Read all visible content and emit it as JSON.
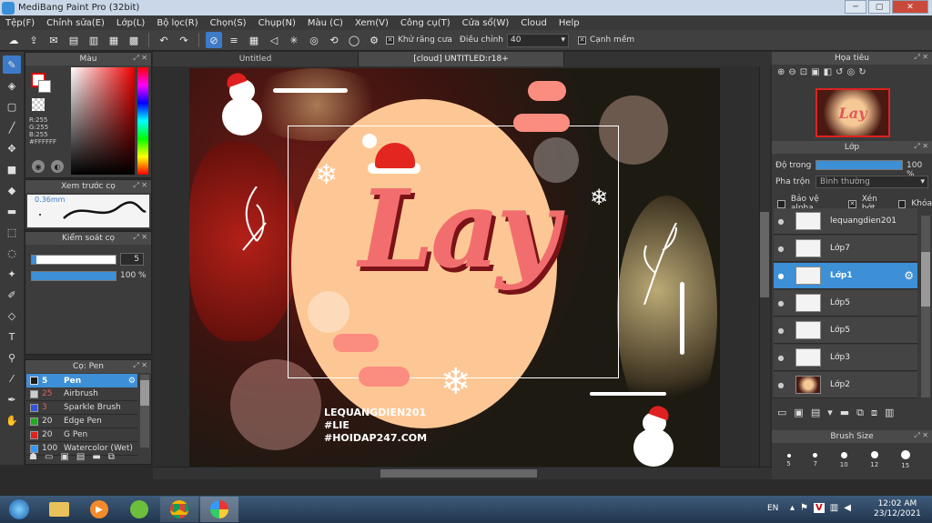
{
  "window": {
    "title": "MediBang Paint Pro (32bit)",
    "controls": [
      "─",
      "▢",
      "✕"
    ]
  },
  "menu": [
    "Tệp(F)",
    "Chỉnh sửa(E)",
    "Lớp(L)",
    "Bộ lọc(R)",
    "Chọn(S)",
    "Chụp(N)",
    "Màu (C)",
    "Xem(V)",
    "Công cụ(T)",
    "Cửa sổ(W)",
    "Cloud",
    "Help"
  ],
  "toolbar": {
    "antialias_label": "Khử răng cưa",
    "adjust_label": "Điều chỉnh",
    "adjust_value": "40",
    "sharp_label": "Cạnh mềm"
  },
  "color_panel": {
    "title": "Màu",
    "r": "R:255",
    "g": "G:255",
    "b": "B:255",
    "hex": "#FFFFFF"
  },
  "preview_panel": {
    "title": "Xem trước cọ",
    "size": "0.36mm"
  },
  "brush_control": {
    "title": "Kiểm soát cọ",
    "size_value": "5",
    "opacity_value": "100 %"
  },
  "brush_list": {
    "title": "Cọ: Pen",
    "items": [
      {
        "size": "5",
        "name": "Pen",
        "color": "#1a1a1a"
      },
      {
        "size": "25",
        "name": "Airbrush",
        "color": "#cccccc"
      },
      {
        "size": "3",
        "name": "Sparkle Brush",
        "color": "#3355dd"
      },
      {
        "size": "20",
        "name": "Edge Pen",
        "color": "#22aa22"
      },
      {
        "size": "20",
        "name": "G Pen",
        "color": "#dd2222"
      },
      {
        "size": "100",
        "name": "Watercolor (Wet)",
        "color": "#3399ff"
      }
    ]
  },
  "tabs": {
    "tab1": "Untitled",
    "tab2": "[cloud] UNTITLED:r18+"
  },
  "canvas": {
    "main_text": "Lay",
    "credit1": "LEQUANGDIEN201",
    "credit2": "#LIE",
    "credit3": "#HOIDAP247.COM"
  },
  "navigator": {
    "title": "Họa tiêu",
    "thumb_text": "Lay"
  },
  "layer_panel": {
    "title": "Lớp",
    "opacity_label": "Độ trong",
    "opacity_value": "100 %",
    "blend_label": "Pha trộn",
    "blend_value": "Bình thường",
    "protect_alpha": "Bảo vệ alpha",
    "clip": "Xén bớt",
    "lock": "Khóa"
  },
  "layers": [
    {
      "name": "lequangdien201",
      "selected": false
    },
    {
      "name": "Lớp7",
      "selected": false
    },
    {
      "name": "Lớp1",
      "selected": true
    },
    {
      "name": "Lớp5",
      "selected": false
    },
    {
      "name": "Lớp5",
      "selected": false
    },
    {
      "name": "Lớp3",
      "selected": false
    },
    {
      "name": "Lớp2",
      "selected": false
    }
  ],
  "brush_size": {
    "title": "Brush Size",
    "sizes": [
      "5",
      "7",
      "10",
      "12",
      "15"
    ]
  },
  "taskbar": {
    "lang": "EN",
    "time": "12:02 AM",
    "date": "23/12/2021"
  }
}
